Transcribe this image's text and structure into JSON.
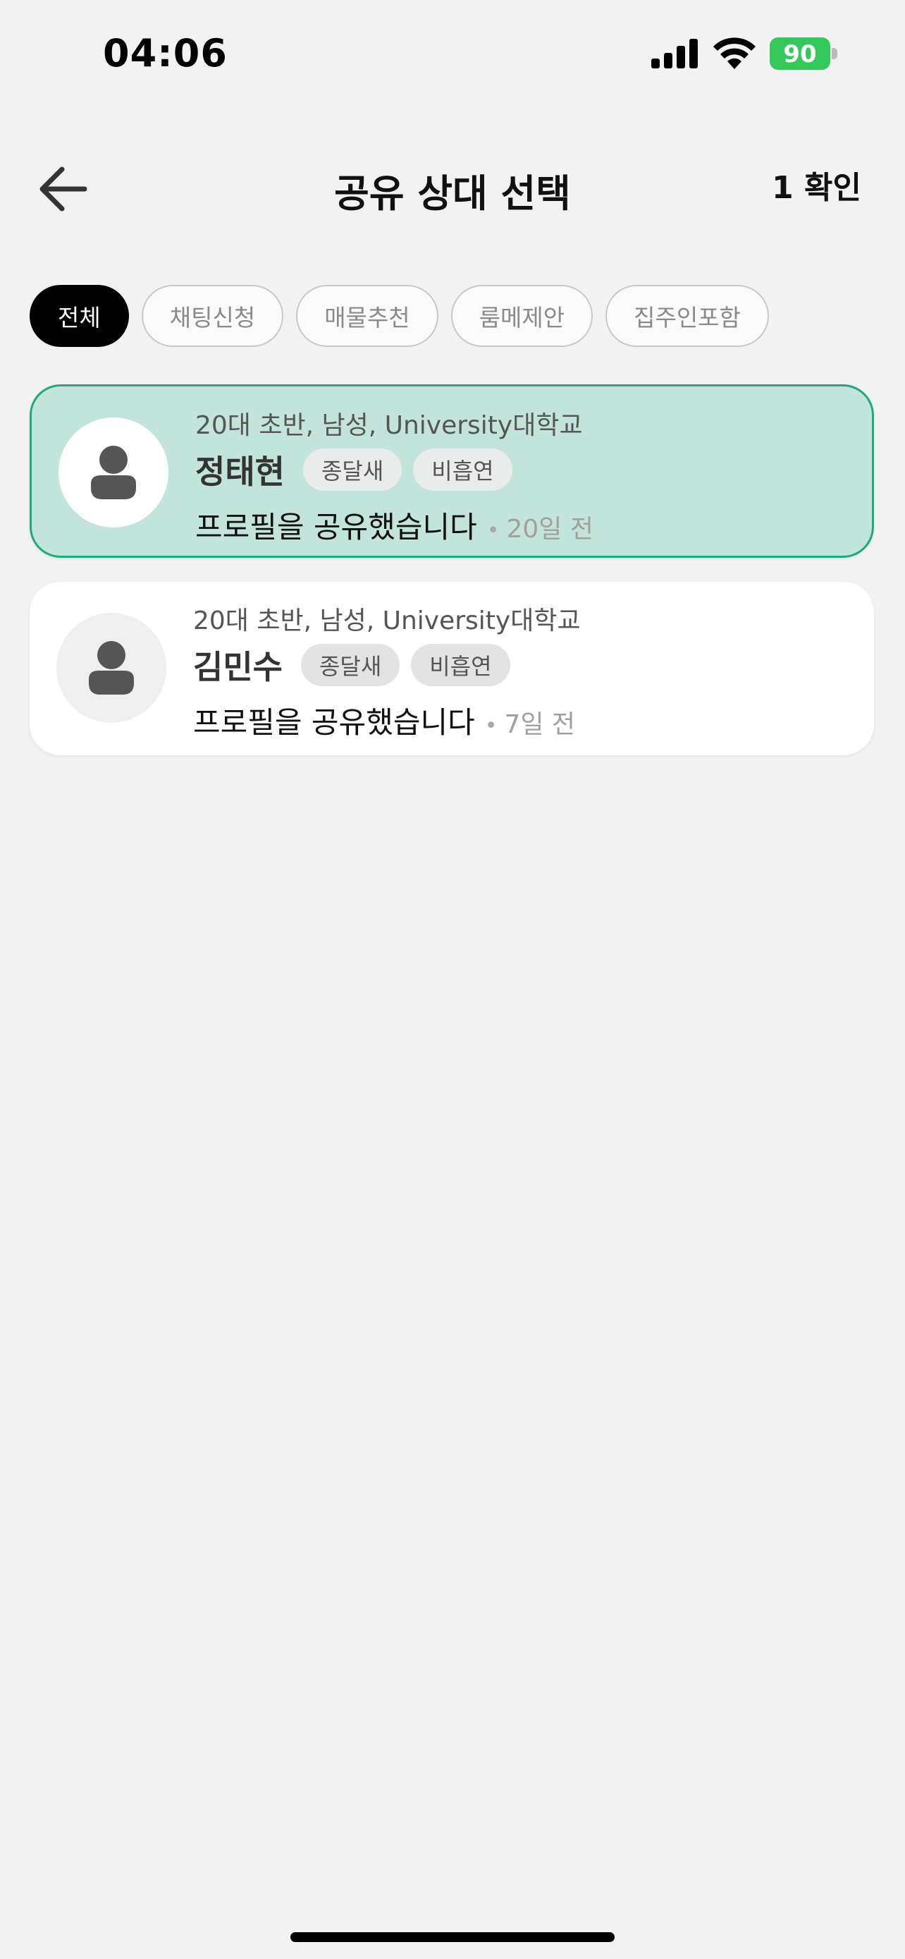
{
  "status_bar": {
    "time": "04:06",
    "battery_level": "90",
    "icons": [
      "cellular-signal-icon",
      "wifi-icon",
      "battery-charging-icon"
    ]
  },
  "header": {
    "back_icon": "arrow-left-icon",
    "title": "공유 상대 선택",
    "confirm_label": "1 확인"
  },
  "filters": [
    {
      "label": "전체",
      "active": true
    },
    {
      "label": "채팅신청",
      "active": false
    },
    {
      "label": "매물추천",
      "active": false
    },
    {
      "label": "룸메제안",
      "active": false
    },
    {
      "label": "집주인포함",
      "active": false
    }
  ],
  "cards": [
    {
      "meta": "20대 초반, 남성, University대학교",
      "name": "정태현",
      "tags": [
        "종달새",
        "비흡연"
      ],
      "status": "프로필을 공유했습니다",
      "time": "20일 전",
      "selected": true
    },
    {
      "meta": "20대 초반, 남성, University대학교",
      "name": "김민수",
      "tags": [
        "종달새",
        "비흡연"
      ],
      "status": "프로필을 공유했습니다",
      "time": "7일 전",
      "selected": false
    }
  ],
  "colors": {
    "accent_selected_bg": "#c3e4da",
    "accent_selected_border": "#1fa97a",
    "battery": "#34c759",
    "background": "#f2f2f2"
  }
}
